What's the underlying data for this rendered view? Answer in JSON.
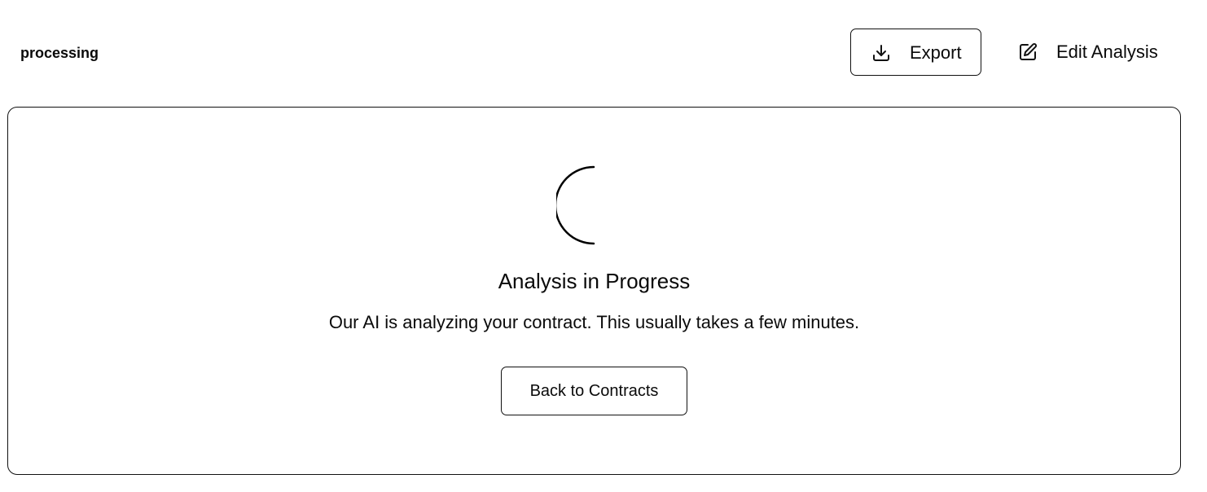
{
  "header": {
    "status": "processing",
    "export_label": "Export",
    "export_icon": "download-icon",
    "edit_label": "Edit Analysis",
    "edit_icon": "edit-icon"
  },
  "progress_card": {
    "spinner_icon": "loading-spinner-icon",
    "title": "Analysis in Progress",
    "description": "Our AI is analyzing your contract. This usually takes a few minutes.",
    "back_label": "Back to Contracts"
  }
}
